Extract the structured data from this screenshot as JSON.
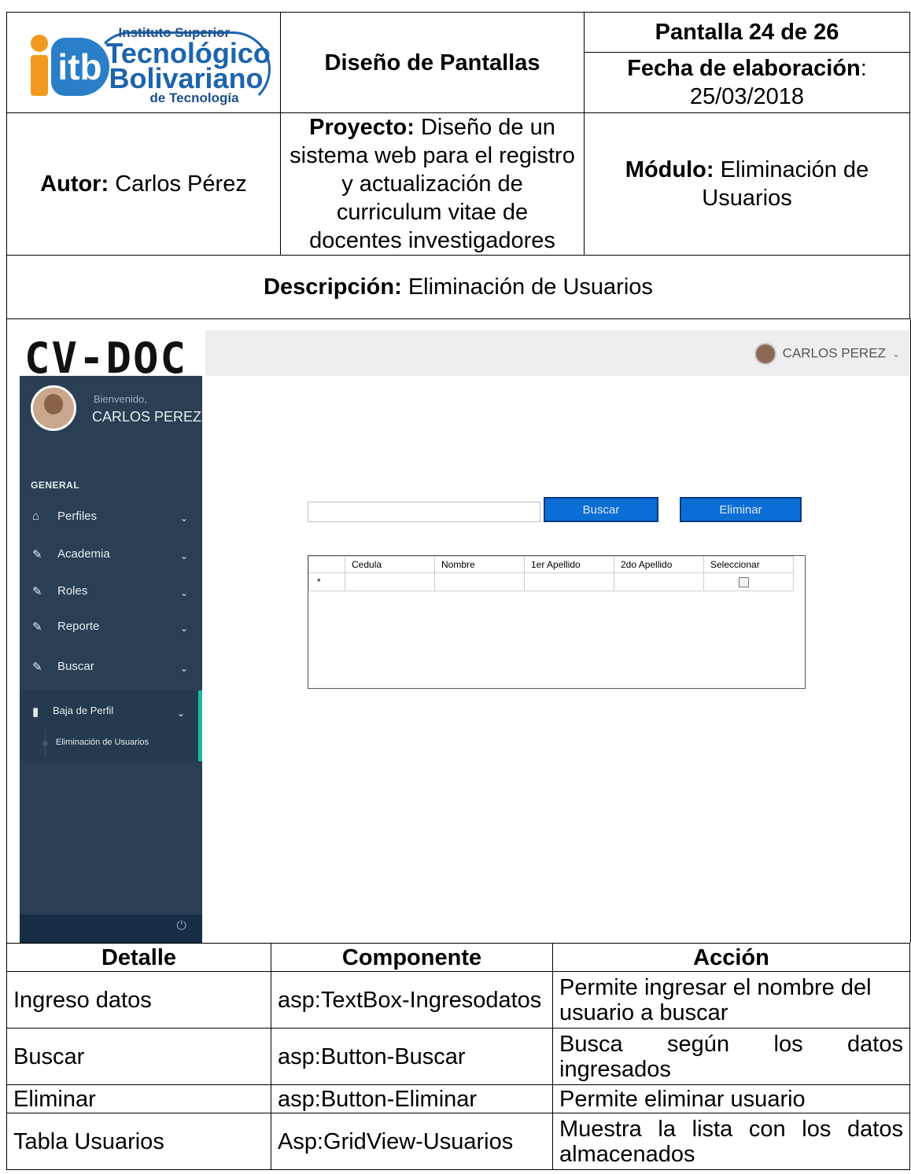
{
  "header": {
    "logo": {
      "line1": "Instituto Superior",
      "line2": "Tecnológico",
      "line3": "Bolivariano",
      "line4": "de Tecnología",
      "mark": "itb"
    },
    "title": "Diseño de Pantallas",
    "screen": "Pantalla 24 de 26",
    "date_label": "Fecha de elaboración",
    "date_value": "25/03/2018",
    "author_label": "Autor:",
    "author_value": "Carlos Pérez",
    "project_label": "Proyecto:",
    "project_value": "Diseño de un sistema web para el registro y actualización de curriculum vitae de docentes investigadores",
    "module_label": "Módulo:",
    "module_value": "Eliminación de Usuarios",
    "description_label": "Descripción:",
    "description_value": "Eliminación de Usuarios"
  },
  "mockup": {
    "brand": "CV-DOC",
    "topbar_user": "CARLOS PEREZ",
    "welcome": "Bienvenido,",
    "user_name": "CARLOS PEREZ",
    "section": "GENERAL",
    "menu": [
      {
        "label": "Perfiles",
        "icon": "home-icon"
      },
      {
        "label": "Academia",
        "icon": "edit-icon"
      },
      {
        "label": "Roles",
        "icon": "edit-icon"
      },
      {
        "label": "Reporte",
        "icon": "edit-icon"
      },
      {
        "label": "Buscar",
        "icon": "edit-icon"
      },
      {
        "label": "Baja de Perfil",
        "icon": "bar-chart-icon"
      }
    ],
    "submenu_item": "Eliminación de Usuarios",
    "search_value": "",
    "buscar_button": "Buscar",
    "eliminar_button": "Eliminar",
    "grid": {
      "columns": [
        "Cedula",
        "Nombre",
        "1er Apellido",
        "2do Apellido",
        "Seleccionar"
      ],
      "new_row_marker": "*"
    },
    "colors": {
      "sidebar": "#2a3f54",
      "accent": "#1abb9c",
      "button": "#0b6dd6"
    }
  },
  "details": {
    "headers": [
      "Detalle",
      "Componente",
      "Acción"
    ],
    "rows": [
      [
        "Ingreso datos",
        "asp:TextBox-Ingresodatos",
        "Permite ingresar el nombre del usuario a buscar"
      ],
      [
        "Buscar",
        "asp:Button-Buscar",
        "Busca según los datos ingresados"
      ],
      [
        "Eliminar",
        "asp:Button-Eliminar",
        "Permite eliminar usuario"
      ],
      [
        "Tabla Usuarios",
        "Asp:GridView-Usuarios",
        "Muestra la lista con los datos almacenados"
      ]
    ]
  }
}
